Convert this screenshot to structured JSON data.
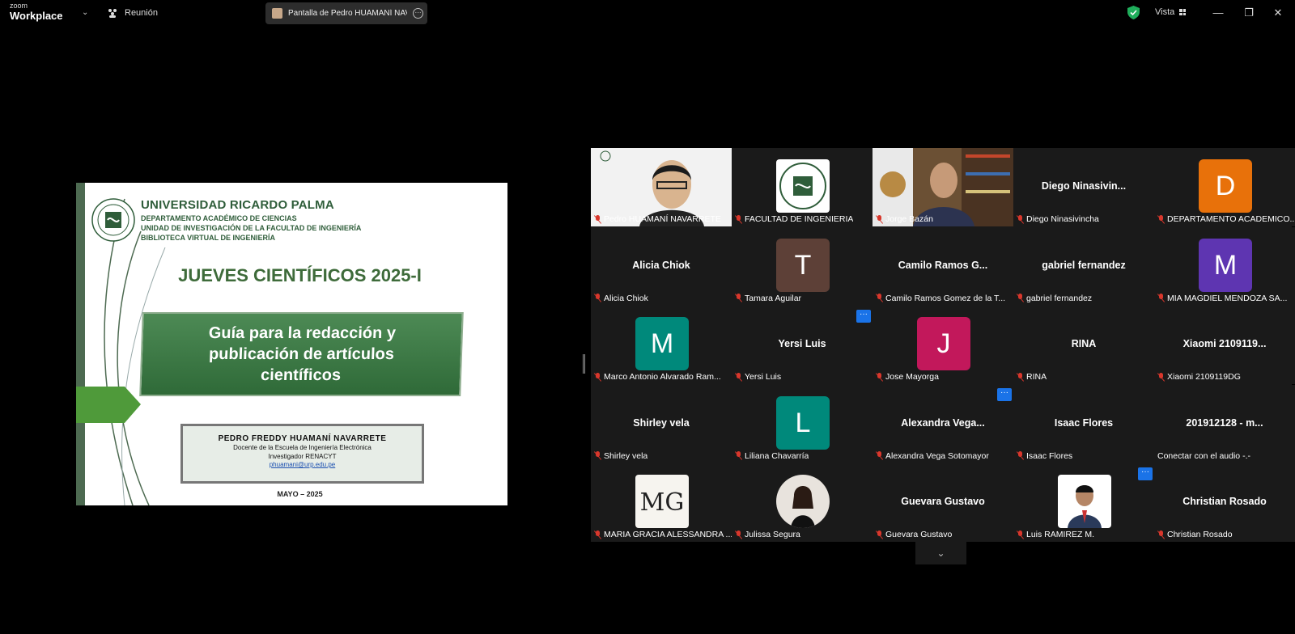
{
  "app": {
    "logo_small": "zoom",
    "logo_big": "Workplace",
    "meeting_label": "Reunión",
    "share_label": "Pantalla de Pedro HUAMANÍ NAVARRETE",
    "view_label": "Vista",
    "accent": "#1a73e8",
    "speaking_color": "#23d18b",
    "shield_color": "#1fae5b"
  },
  "slide": {
    "university": "UNIVERSIDAD RICARDO PALMA",
    "dept1": "DEPARTAMENTO ACADÉMICO DE CIENCIAS",
    "dept2": "UNIDAD DE INVESTIGACIÓN DE LA FACULTAD DE INGENIERÍA",
    "dept3": "BIBLIOTECA VIRTUAL DE INGENIERÍA",
    "event": "JUEVES CIENTÍFICOS 2025-I",
    "guide_l1": "Guía para la redacción y",
    "guide_l2": "publicación de artículos",
    "guide_l3": "científicos",
    "author": "PEDRO  FREDDY  HUAMANÍ  NAVARRETE",
    "role1": "Docente de la Escuela de Ingeniería Electrónica",
    "role2": "Investigador RENACYT",
    "email": "phuamani@urp.edu.pe",
    "date": "MAYO – 2025"
  },
  "participants": [
    {
      "name": "Pedro HUAMANÍ NAVARRETE",
      "kind": "video-person"
    },
    {
      "name": "FACULTAD DE INGENIERIA",
      "kind": "seal"
    },
    {
      "name": "Jorge Bazán",
      "kind": "video-office",
      "speaking": true
    },
    {
      "name": "Diego Ninasivincha",
      "display": "Diego  Ninasivin...",
      "kind": "text"
    },
    {
      "name": "DEPARTAMENTO ACADEMICO...",
      "kind": "avatar",
      "letter": "D",
      "color": "#e8710a"
    },
    {
      "name": "Alicia Chiok",
      "display": "Alicia Chiok",
      "kind": "text"
    },
    {
      "name": "Tamara Aguilar",
      "kind": "avatar",
      "letter": "T",
      "color": "#5d4037"
    },
    {
      "name": "Camilo Ramos Gomez de la T...",
      "display": "Camilo  Ramos  G...",
      "kind": "text"
    },
    {
      "name": "gabriel fernandez",
      "display": "gabriel fernandez",
      "kind": "text"
    },
    {
      "name": "MIA MAGDIEL MENDOZA SA...",
      "kind": "avatar",
      "letter": "M",
      "color": "#5e35b1"
    },
    {
      "name": "Marco Antonio Alvarado Ram...",
      "kind": "avatar",
      "letter": "M",
      "color": "#00897b"
    },
    {
      "name": "Yersi Luis",
      "display": "Yersi Luis",
      "kind": "text"
    },
    {
      "name": "Jose Mayorga",
      "kind": "avatar",
      "letter": "J",
      "color": "#c2185b"
    },
    {
      "name": "RINA",
      "display": "RINA",
      "kind": "text"
    },
    {
      "name": "Xiaomi 2109119DG",
      "display": "Xiaomi 2109119...",
      "kind": "text"
    },
    {
      "name": "Shirley vela",
      "display": "Shirley vela",
      "kind": "text"
    },
    {
      "name": "Liliana Chavarría",
      "kind": "avatar",
      "letter": "L",
      "color": "#00897b"
    },
    {
      "name": "Alexandra Vega Sotomayor",
      "display": "Alexandra  Vega...",
      "kind": "text"
    },
    {
      "name": "Isaac Flores",
      "display": "Isaac Flores",
      "kind": "text"
    },
    {
      "name": "Conectar con el audio -.-",
      "display": "201912128 -  m...",
      "kind": "text",
      "nomic": true
    },
    {
      "name": "MARIA GRACIA ALESSANDRA ...",
      "kind": "logo-mg"
    },
    {
      "name": "Julissa Segura",
      "kind": "photo-woman"
    },
    {
      "name": "Guevara Gustavo",
      "display": "Guevara Gustavo",
      "kind": "text"
    },
    {
      "name": "Luis RAMIREZ M.",
      "kind": "photo-man"
    },
    {
      "name": "Christian Rosado",
      "display": "Christian Rosado",
      "kind": "text"
    }
  ]
}
